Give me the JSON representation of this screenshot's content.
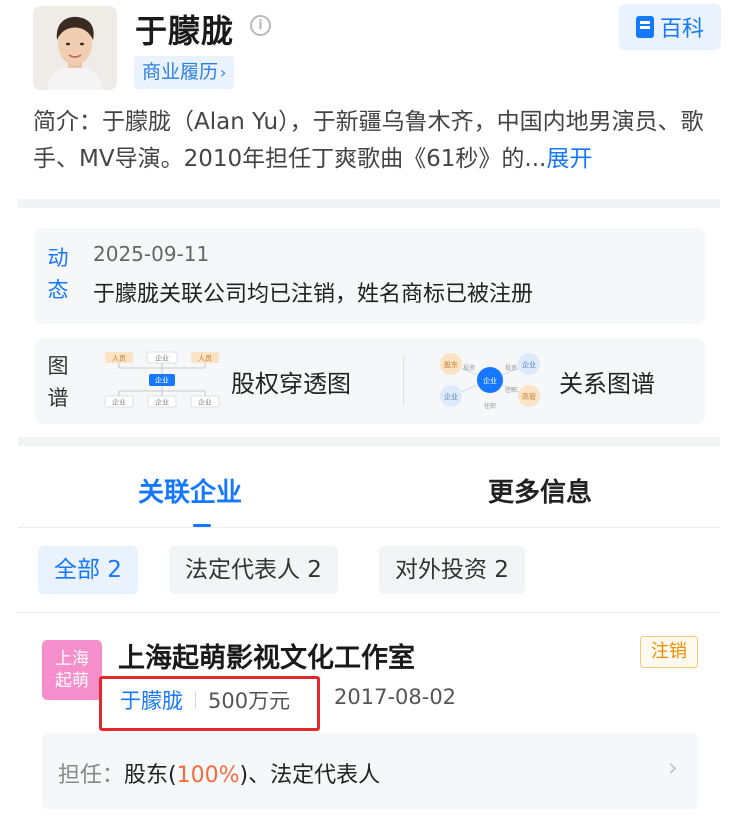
{
  "profile": {
    "name": "于朦胧",
    "info_icon": "i",
    "baike_label": "百科",
    "biz_tag": "商业履历",
    "biz_tag_chevron": "›",
    "intro": "简介：于朦胧（Alan Yu），于新疆乌鲁木齐，中国内地男演员、歌手、MV导演。2010年担任丁爽歌曲《61秒》的...",
    "intro_more": "展开"
  },
  "dynamic": {
    "label_line1": "动",
    "label_line2": "态",
    "date": "2025-09-11",
    "text": "于朦胧关联公司均已注销，姓名商标已被注册"
  },
  "graph": {
    "label_line1": "图",
    "label_line2": "谱",
    "equity_label": "股权穿透图",
    "relation_label": "关系图谱",
    "equity_thumb": {
      "person": "人员",
      "company": "企业"
    },
    "relation_thumb": {
      "shareholder": "股东",
      "invest": "投资",
      "company": "企业",
      "executive": "高管",
      "appoint": "任职"
    }
  },
  "tabs": {
    "active": "关联企业",
    "more": "更多信息"
  },
  "filters": {
    "all": "全部 2",
    "legal_rep": "法定代表人 2",
    "investment": "对外投资 2"
  },
  "company": {
    "logo_line1": "上海",
    "logo_line2": "起萌",
    "name": "上海起萌影视文化工作室",
    "status": "注销",
    "person": "于朦胧",
    "capital": "500万元",
    "date": "2017-08-02",
    "role_label": "担任：",
    "role_prefix": "股东(",
    "role_pct": "100%",
    "role_suffix": ")、法定代表人",
    "role_chevron": "›"
  },
  "colors": {
    "accent": "#1677ff",
    "status": "#f08c00",
    "highlight": "#e5282c",
    "logo": "#f48fcb"
  }
}
